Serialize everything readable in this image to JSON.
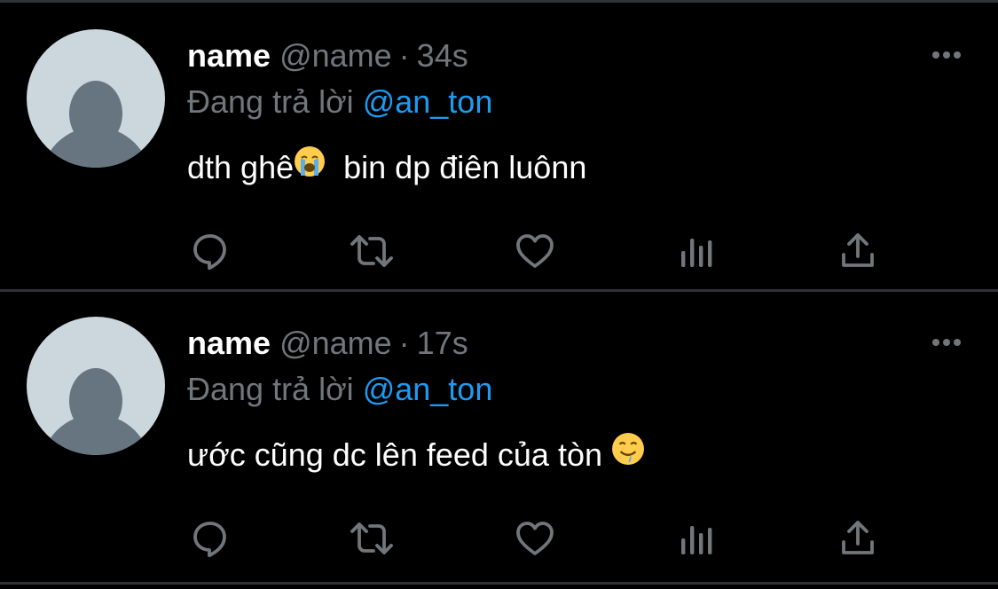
{
  "tweets": [
    {
      "name": "name",
      "handle": "@name",
      "separator": "·",
      "time": "34s",
      "reply_prefix": "Đang trả lời ",
      "reply_to": "@an_ton",
      "text_before_emoji": "dth ghê",
      "emoji": "loudly-crying-face",
      "text_after_emoji": "  bin dp điên luônn"
    },
    {
      "name": "name",
      "handle": "@name",
      "separator": "·",
      "time": "17s",
      "reply_prefix": "Đang trả lời ",
      "reply_to": "@an_ton",
      "text_before_emoji": "ước cũng dc lên feed của tòn ",
      "emoji": "drooling-face",
      "text_after_emoji": ""
    }
  ],
  "actions": [
    "reply-icon",
    "retweet-icon",
    "like-icon",
    "analytics-icon",
    "share-icon"
  ],
  "colors": {
    "background": "#000000",
    "divider": "#2f3336",
    "secondary_text": "#71767b",
    "mention": "#1d9bf0",
    "avatar_bg": "#ccd6dd",
    "avatar_fg": "#66757f"
  }
}
